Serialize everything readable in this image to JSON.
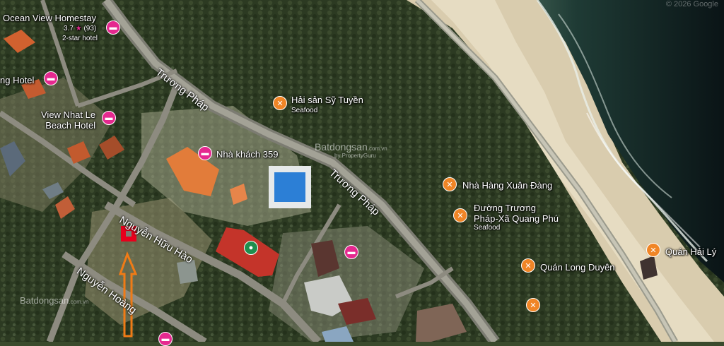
{
  "copyright": "© 2026 Google",
  "watermark": {
    "brand": "Batdongsan",
    "tagline": "by PropertyGuru",
    "domain": ".com.vn"
  },
  "roads": {
    "truong_phap_upper": "Trương Pháp",
    "truong_phap_lower": "Trương Pháp",
    "nguyen_huu_hao": "Nguyễn Hữu Hào",
    "nguyen_hoang": "Nguyễn Hoàng"
  },
  "places": {
    "ocean_view": {
      "name": "Ocean View Homestay",
      "rating": "3.7",
      "star": "★",
      "reviews": "(93)",
      "category": "2-star hotel"
    },
    "hotel_left": {
      "name": "ng Hotel"
    },
    "view_nhat_le": {
      "name_line1": "View Nhat Le",
      "name_line2": "Beach Hotel"
    },
    "nha_khach": {
      "name": "Nhà khách 359"
    },
    "hai_san": {
      "name": "Hải sản Sỹ Tuyền",
      "category": "Seafood"
    },
    "nha_hang": {
      "name": "Nhà Hàng Xuân Đàng"
    },
    "duong_truong": {
      "name_line1": "Đường Trương",
      "name_line2": "Pháp-Xã Quang Phú",
      "category": "Seafood"
    },
    "quan_long_duyen": {
      "name": "Quán Long Duyên"
    },
    "quan_hai_ly": {
      "name": "Quán Hải Lý"
    }
  },
  "icons": {
    "hotel": "bed-icon",
    "food": "fork-knife-icon",
    "landmark": "circle-dot-icon"
  },
  "colors": {
    "hotel_pin": "#e5298f",
    "food_pin": "#f08526",
    "landmark_pin": "#1e8f4e",
    "marker": "#e8001c",
    "arrow": "#f07b16"
  }
}
